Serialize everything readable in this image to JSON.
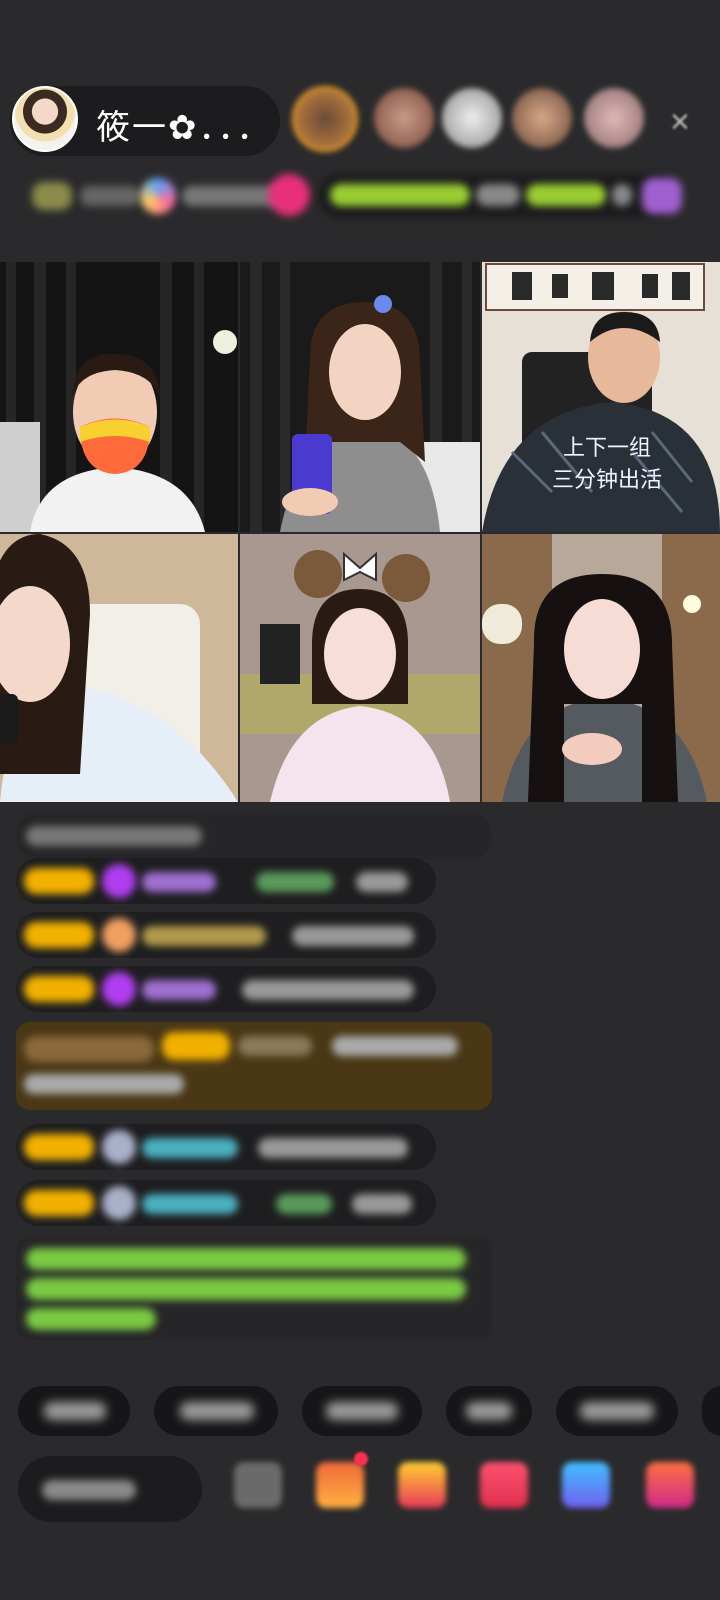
{
  "host": {
    "name": "筱一✿．．．",
    "avatar_icon": "host-avatar"
  },
  "viewer_avatars": [
    {
      "color": "#d08a3a"
    },
    {
      "color": "#a86a5a"
    },
    {
      "color": "#d8d8d8"
    },
    {
      "color": "#b07a5a"
    },
    {
      "color": "#c89a9a"
    }
  ],
  "close_icon": "×",
  "video_grid": {
    "caption_line1": "上下一组",
    "caption_line2": "三分钟出活"
  },
  "colors": {
    "background": "#2a2a2c",
    "badge_gold": "#f2b100",
    "chat_bg": "#1e1e20",
    "highlight_bg": "#4a3716",
    "green_text": "#7ac943",
    "purple": "#b03ef0"
  }
}
